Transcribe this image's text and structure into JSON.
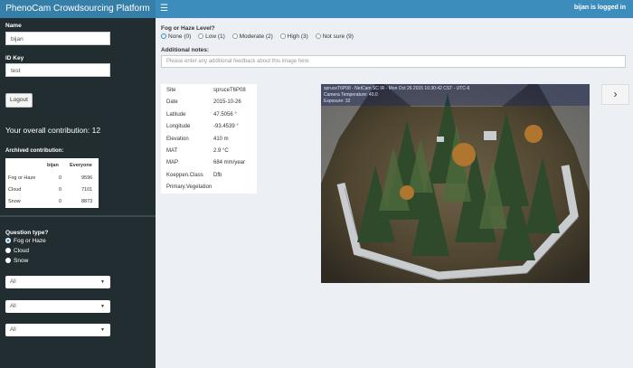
{
  "header": {
    "title": "PhenoCam Crowdsourcing Platform",
    "menu_icon": "hamburger-icon",
    "user_text": "bijan is logged in"
  },
  "sidebar": {
    "name_label": "Name",
    "name_value": "bijan",
    "id_label": "ID Key",
    "id_value": "test",
    "logout_label": "Logout",
    "contribution_text": "Your overall contribution: 12",
    "archived_label": "Archived contribution:",
    "stats": {
      "columns": [
        "",
        "bijan",
        "Everyone"
      ],
      "rows": [
        {
          "label": "Fog or Haze",
          "bijan": "0",
          "everyone": "9596"
        },
        {
          "label": "Cloud",
          "bijan": "0",
          "everyone": "7101"
        },
        {
          "label": "Snow",
          "bijan": "0",
          "everyone": "8873"
        }
      ]
    },
    "question_label": "Question type?",
    "question_options": [
      "Fog or Haze",
      "Cloud",
      "Snow"
    ],
    "question_selected": "Fog or Haze",
    "filters": [
      "All",
      "All",
      "All"
    ]
  },
  "main": {
    "fog_question": "Fog or Haze Level?",
    "fog_options": [
      "None (0)",
      "Low (1)",
      "Moderate (2)",
      "High (3)",
      "Not sure (9)"
    ],
    "fog_selected": "None (0)",
    "notes_label": "Additional notes:",
    "notes_placeholder": "Please enter any additional feedback about this image here",
    "metadata": [
      {
        "key": "Site",
        "value": "spruceT6P08"
      },
      {
        "key": "Date",
        "value": "2015-10-26"
      },
      {
        "key": "Latitude",
        "value": "47.5056 °"
      },
      {
        "key": "Longitude",
        "value": "-93.4539 °"
      },
      {
        "key": "Elevation",
        "value": "410 m"
      },
      {
        "key": "MAT",
        "value": "2.9 °C"
      },
      {
        "key": "MAP",
        "value": "684 mm/year"
      },
      {
        "key": "Koeppen.Class",
        "value": "Dfb"
      },
      {
        "key": "Primary.Vegetation",
        "value": ""
      }
    ],
    "image_overlay": [
      "spruceT6P08 - NetCam SC IR - Mon Oct 26 2015 16:30:42 CST - UTC-6",
      "Camera Temperature: 40.0",
      "Exposure: 32"
    ],
    "next_icon": "chevron-right-icon",
    "next_label": "›"
  },
  "colors": {
    "header": "#3c8dbc",
    "header_logo": "#367fa9",
    "sidebar": "#222d32",
    "content": "#ecf0f5"
  }
}
